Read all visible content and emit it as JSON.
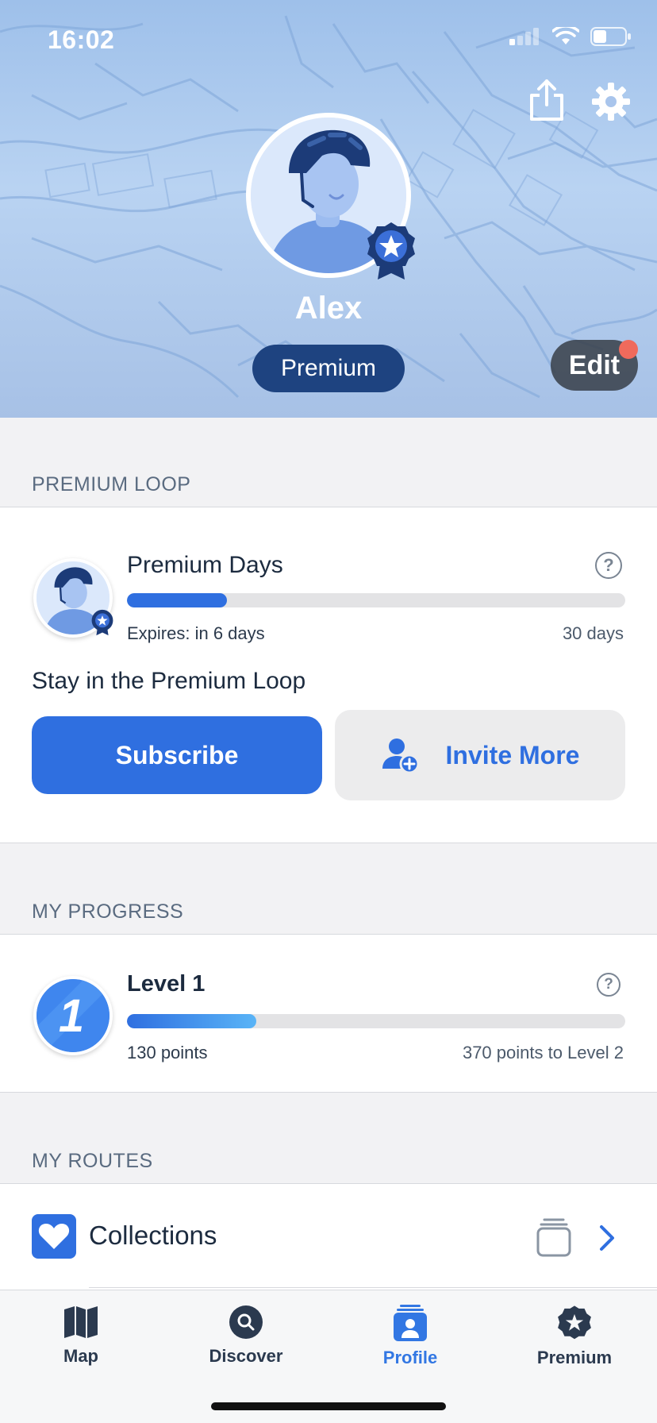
{
  "status_bar": {
    "time": "16:02"
  },
  "profile": {
    "name": "Alex",
    "tier_badge": "Premium",
    "edit_label": "Edit"
  },
  "premium_loop": {
    "section_title": "PREMIUM LOOP",
    "title": "Premium Days",
    "expires": "Expires: in 6 days",
    "total": "30 days",
    "progress": 0.2,
    "promo": "Stay in the Premium Loop",
    "subscribe_label": "Subscribe",
    "invite_label": "Invite More"
  },
  "progress": {
    "section_title": "MY PROGRESS",
    "level_title": "Level 1",
    "level_number": "1",
    "points": "130 points",
    "remaining": "370 points to Level 2",
    "progress": 0.26
  },
  "routes": {
    "section_title": "MY ROUTES",
    "collections_label": "Collections"
  },
  "tabs": [
    {
      "label": "Map",
      "icon": "map-icon",
      "active": false
    },
    {
      "label": "Discover",
      "icon": "search-icon",
      "active": false
    },
    {
      "label": "Profile",
      "icon": "profile-icon",
      "active": true
    },
    {
      "label": "Premium",
      "icon": "premium-icon",
      "active": false
    }
  ],
  "colors": {
    "accent": "#2f6fe0",
    "premium_pill": "#1e4380",
    "header_bg": "#b3cdf0"
  }
}
